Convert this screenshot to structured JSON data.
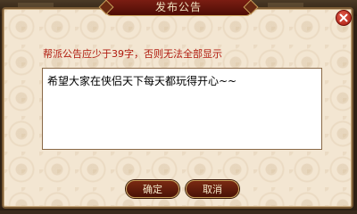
{
  "dialog": {
    "title": "发布公告",
    "hint": "帮派公告应少于39字，否则无法全部显示",
    "announcement_value": "希望大家在侠侣天下每天都玩得开心~~",
    "ok_label": "确定",
    "cancel_label": "取消"
  },
  "icons": {
    "close": "close-icon"
  },
  "colors": {
    "hint": "#b01a0e",
    "title_bg": "#7a1d12",
    "panel_bg": "#f3e6d2",
    "button_bg": "#6a1e0c",
    "close_bg": "#c8281a"
  }
}
